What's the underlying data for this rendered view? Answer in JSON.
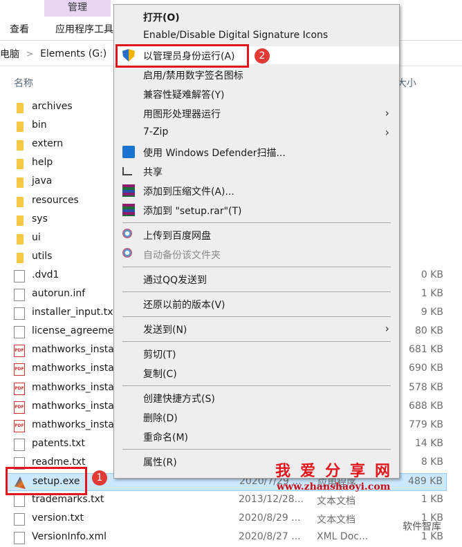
{
  "ribbon": {
    "manage_tab": "管理",
    "view_tab": "查看",
    "app_tools_tab": "应用程序工具"
  },
  "breadcrumb": [
    "电脑",
    "Elements (G:)"
  ],
  "columns": {
    "name": "名称",
    "size": "大小"
  },
  "files": [
    {
      "name": "archives",
      "icon": "folder"
    },
    {
      "name": "bin",
      "icon": "folder"
    },
    {
      "name": "extern",
      "icon": "folder"
    },
    {
      "name": "help",
      "icon": "folder"
    },
    {
      "name": "java",
      "icon": "folder"
    },
    {
      "name": "resources",
      "icon": "folder"
    },
    {
      "name": "sys",
      "icon": "folder"
    },
    {
      "name": "ui",
      "icon": "folder"
    },
    {
      "name": "utils",
      "icon": "folder"
    },
    {
      "name": ".dvd1",
      "icon": "doc",
      "size": "0 KB"
    },
    {
      "name": "autorun.inf",
      "icon": "doc",
      "size": "1 KB"
    },
    {
      "name": "installer_input.txt",
      "icon": "doc",
      "size": "9 KB"
    },
    {
      "name": "license_agreement",
      "icon": "doc",
      "size": "80 KB"
    },
    {
      "name": "mathworks_insta",
      "icon": "pdf",
      "size": "681 KB"
    },
    {
      "name": "mathworks_insta",
      "icon": "pdf",
      "size": "690 KB"
    },
    {
      "name": "mathworks_insta",
      "icon": "pdf",
      "size": "578 KB"
    },
    {
      "name": "mathworks_insta",
      "icon": "pdf",
      "size": "688 KB"
    },
    {
      "name": "mathworks_insta",
      "icon": "pdf",
      "size": "779 KB"
    },
    {
      "name": "patents.txt",
      "icon": "doc",
      "size": "14 KB"
    },
    {
      "name": "readme.txt",
      "icon": "doc",
      "size": "8 KB"
    },
    {
      "name": "setup.exe",
      "icon": "matlab",
      "date": "2020/7/29 ...",
      "type": "应用程序",
      "size": "489 KB",
      "selected": true
    },
    {
      "name": "trademarks.txt",
      "icon": "doc",
      "date": "2013/12/28...",
      "type": "文本文档",
      "size": "1 KB"
    },
    {
      "name": "version.txt",
      "icon": "doc",
      "date": "2020/8/29 ...",
      "type": "文本文档",
      "size": "1 KB"
    },
    {
      "name": "VersionInfo.xml",
      "icon": "doc",
      "date": "2020/8/27 ...",
      "type": "XML Doc...",
      "size": "1 KB"
    }
  ],
  "context_menu": [
    {
      "label": "打开(O)",
      "bold": true
    },
    {
      "label": "Enable/Disable Digital Signature Icons"
    },
    {
      "label": "以管理员身份运行(A)",
      "icon": "shield",
      "highlighted": true
    },
    {
      "label": "启用/禁用数字签名图标"
    },
    {
      "label": "兼容性疑难解答(Y)"
    },
    {
      "label": "用图形处理器运行",
      "submenu": true
    },
    {
      "label": "7-Zip",
      "submenu": true
    },
    {
      "label": "使用 Windows Defender扫描...",
      "icon": "defender"
    },
    {
      "label": "共享",
      "icon": "share"
    },
    {
      "label": "添加到压缩文件(A)...",
      "icon": "winrar"
    },
    {
      "label": "添加到 \"setup.rar\"(T)",
      "icon": "winrar"
    },
    {
      "separator": true
    },
    {
      "label": "上传到百度网盘",
      "icon": "baidu"
    },
    {
      "label": "自动备份该文件夹",
      "icon": "baidu",
      "disabled": true
    },
    {
      "separator": true
    },
    {
      "label": "通过QQ发送到"
    },
    {
      "separator": true
    },
    {
      "label": "还原以前的版本(V)"
    },
    {
      "separator": true
    },
    {
      "label": "发送到(N)",
      "submenu": true
    },
    {
      "separator": true
    },
    {
      "label": "剪切(T)"
    },
    {
      "label": "复制(C)"
    },
    {
      "separator": true
    },
    {
      "label": "创建快捷方式(S)"
    },
    {
      "label": "删除(D)"
    },
    {
      "label": "重命名(M)"
    },
    {
      "separator": true
    },
    {
      "label": "属性(R)"
    }
  ],
  "annotations": {
    "step1": "1",
    "step2": "2"
  },
  "watermark": {
    "title": "我爱分享网",
    "url": "www.zhanshaoyi.com",
    "wechat": "软件智库"
  },
  "colors": {
    "highlight_box": "#e0161c",
    "selection": "#cce8ff",
    "menu_bg": "#eeeeee"
  }
}
